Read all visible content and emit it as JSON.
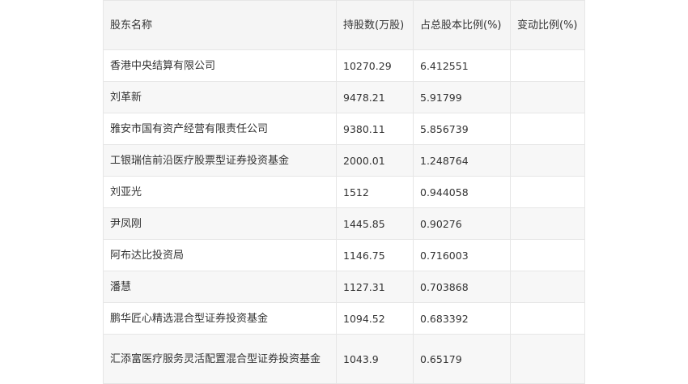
{
  "table": {
    "headers": [
      "股东名称",
      "持股数(万股)",
      "占总股本比例(%)",
      "变动比例(%)"
    ],
    "rows": [
      {
        "name": "香港中央结算有限公司",
        "shares": "10270.29",
        "ratio": "6.412551",
        "change": ""
      },
      {
        "name": "刘革新",
        "shares": "9478.21",
        "ratio": "5.91799",
        "change": ""
      },
      {
        "name": "雅安市国有资产经营有限责任公司",
        "shares": "9380.11",
        "ratio": "5.856739",
        "change": ""
      },
      {
        "name": "工银瑞信前沿医疗股票型证券投资基金",
        "shares": "2000.01",
        "ratio": "1.248764",
        "change": ""
      },
      {
        "name": "刘亚光",
        "shares": "1512",
        "ratio": "0.944058",
        "change": ""
      },
      {
        "name": "尹凤刚",
        "shares": "1445.85",
        "ratio": "0.90276",
        "change": ""
      },
      {
        "name": "阿布达比投资局",
        "shares": "1146.75",
        "ratio": "0.716003",
        "change": ""
      },
      {
        "name": "潘慧",
        "shares": "1127.31",
        "ratio": "0.703868",
        "change": ""
      },
      {
        "name": "鹏华匠心精选混合型证券投资基金",
        "shares": "1094.52",
        "ratio": "0.683392",
        "change": ""
      },
      {
        "name": "汇添富医疗服务灵活配置混合型证券投资基金",
        "shares": "1043.9",
        "ratio": "0.65179",
        "change": ""
      }
    ]
  }
}
